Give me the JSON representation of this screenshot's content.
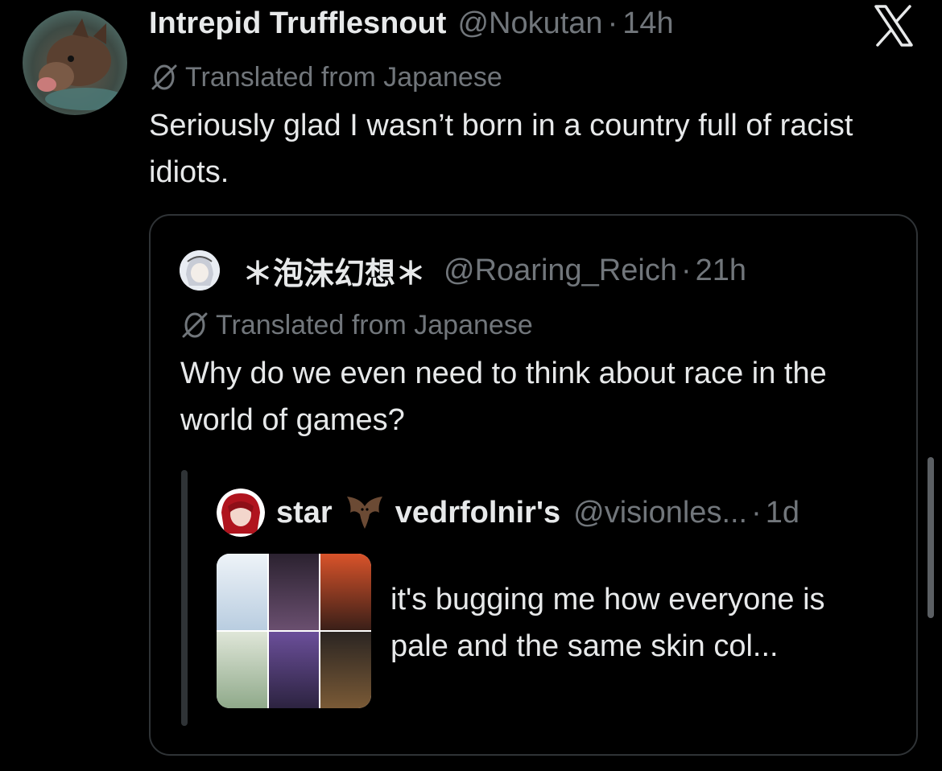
{
  "tweet": {
    "author_name": "Intrepid Trufflesnout",
    "handle": "@Nokutan",
    "separator": "·",
    "time": "14h",
    "translated_label": "Translated from Japanese",
    "text": "Seriously glad I wasn’t born in a country full of racist idiots."
  },
  "quote": {
    "author_name": "＊泡沫幻想＊",
    "handle": "@Roaring_Reich",
    "separator": "·",
    "time": "21h",
    "translated_label": "Translated from Japanese",
    "text": "Why do we even need to think about race in the world of games?"
  },
  "nested_quote": {
    "author_name_part1": "star",
    "author_name_part2": "vedrfolnir's",
    "handle": "@visionles...",
    "separator": "·",
    "time": "1d",
    "text": "it's bugging me how everyone is pale and the same skin col..."
  },
  "colors": {
    "background": "#000000",
    "primary_text": "#e7e9ea",
    "secondary_text": "#71767b",
    "border": "#2f3336"
  },
  "icons": {
    "brand": "x-logo-icon",
    "translate": "translate-icon",
    "emoji": "bat-emoji-icon"
  }
}
